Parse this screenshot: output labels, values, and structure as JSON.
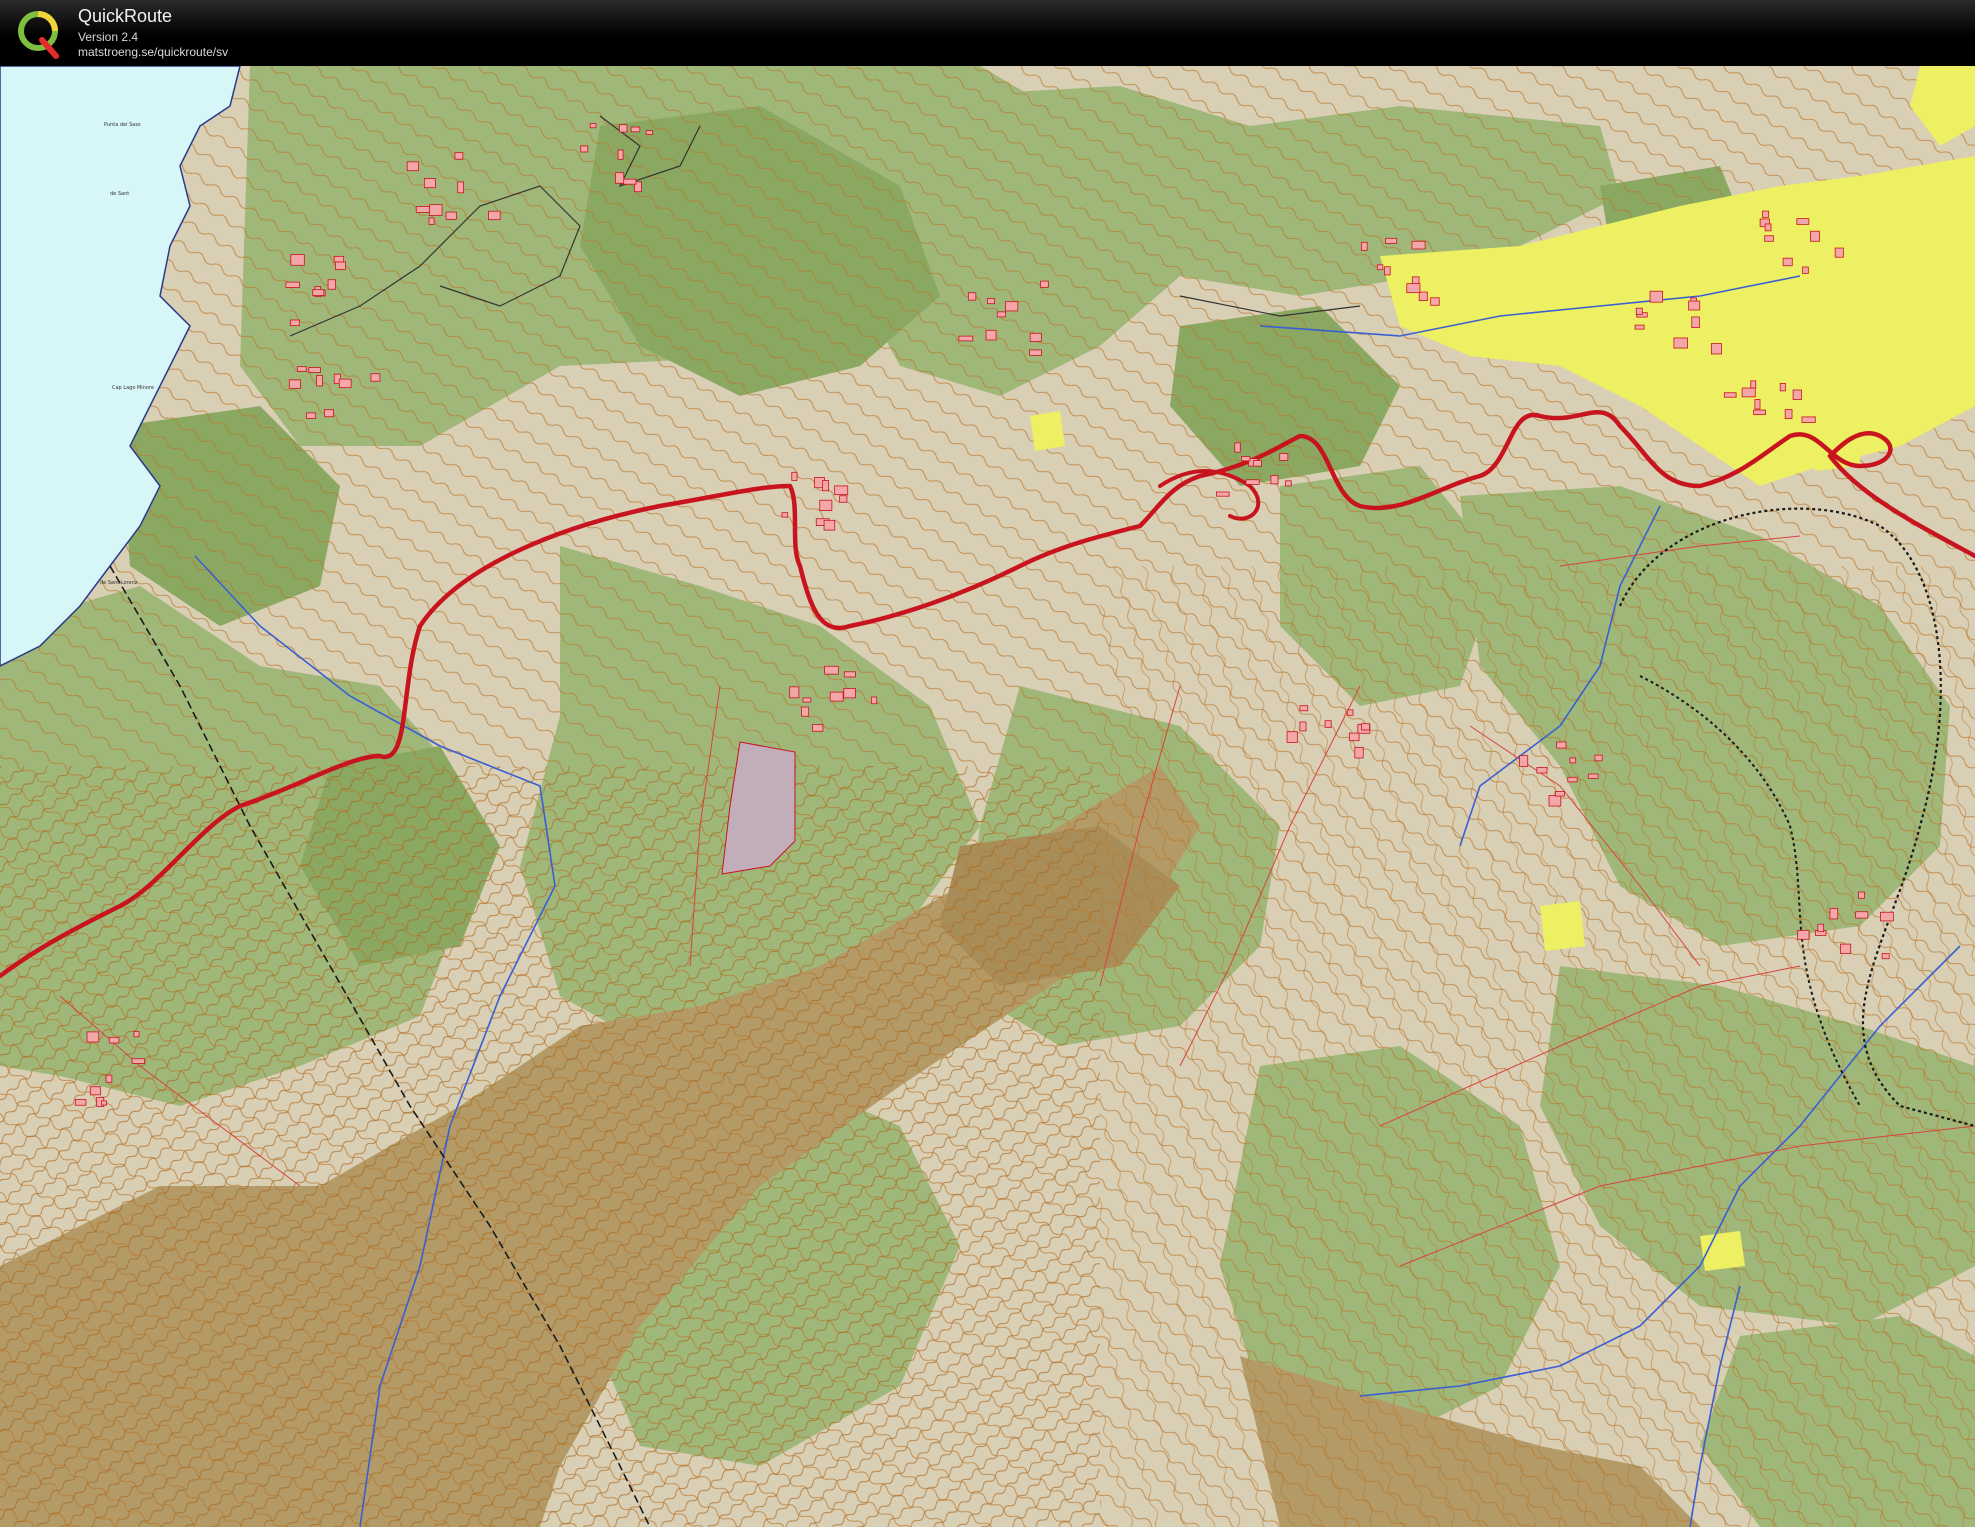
{
  "app": {
    "logo_letter": "Q",
    "title": "QuickRoute",
    "version": "Version 2.4",
    "url": "matstroeng.se/quickroute/sv"
  },
  "map": {
    "labels": {
      "label_1": "Punta dei Sass",
      "label_2": "de Sant",
      "label_3": "Cap Lago Minore",
      "label_4": "de Sant Lorenz"
    },
    "colors": {
      "open_land": "#d9cfb5",
      "forest": "#9fb879",
      "dense_forest": "#8aa862",
      "rough_brown": "#b39a66",
      "water": "#d6f6f8",
      "yellow_field": "#eef063",
      "route": "#c8141e",
      "contour": "#b9772a",
      "stream": "#3a5fd1",
      "building": "#f3a7a8",
      "marsh": "#c2aebb"
    }
  }
}
